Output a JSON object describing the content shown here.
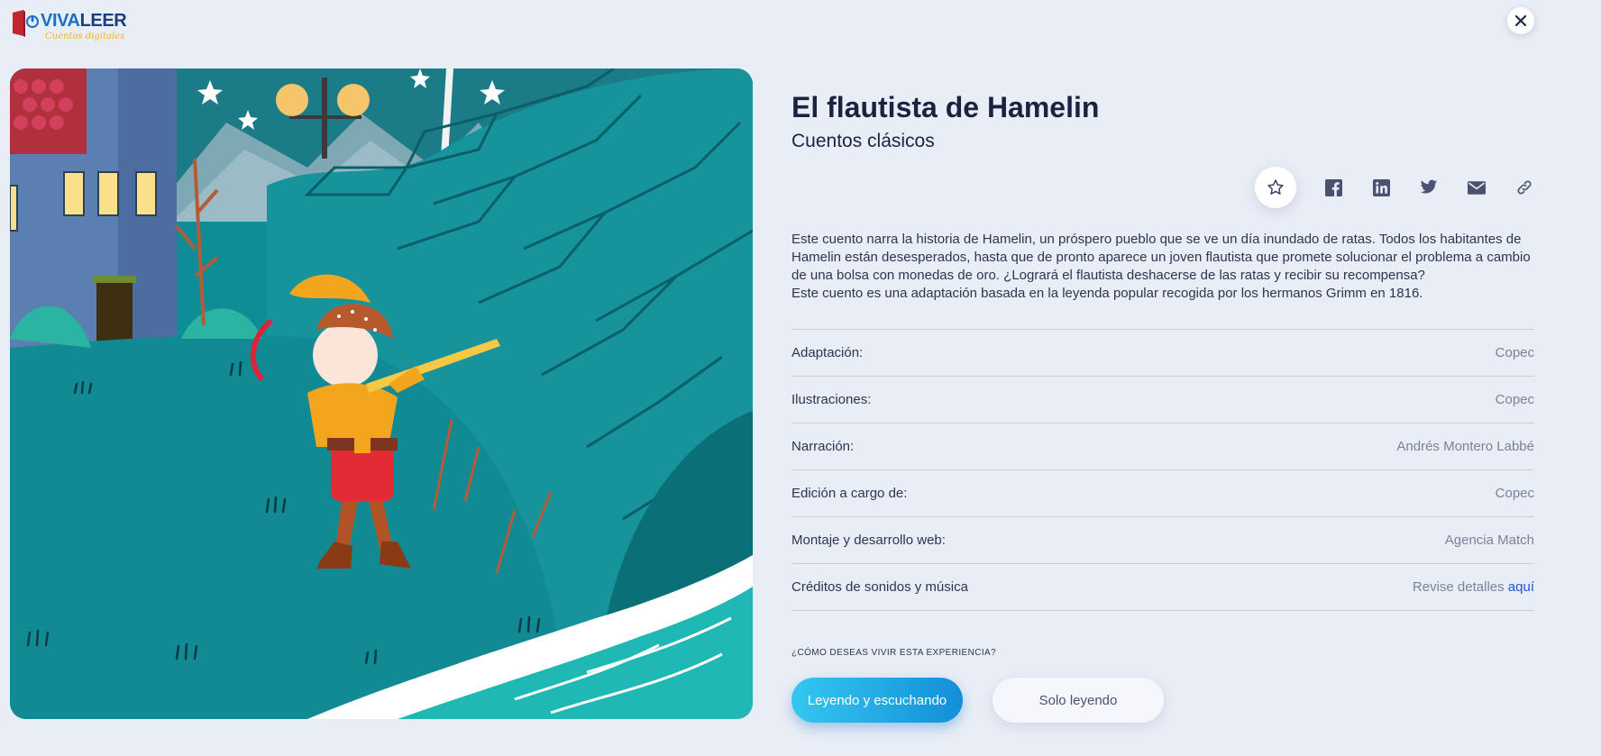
{
  "brand": {
    "name_part1": "VIVA",
    "name_part2": "LEER",
    "tagline": "Cuentos digitales"
  },
  "header": {
    "close_icon": "close-icon"
  },
  "story": {
    "title": "El flautista de Hamelin",
    "category": "Cuentos clásicos",
    "description": [
      "Este cuento narra la historia de Hamelin, un próspero pueblo que se ve un día inundado de ratas. Todos los habitantes de Hamelin están desesperados, hasta que de pronto aparece un joven flautista que promete solucionar el problema a cambio de una bolsa con monedas de oro. ¿Logrará el flautista deshacerse de las ratas y recibir su recompensa?",
      "Este cuento es una adaptación basada en la leyenda popular recogida por los hermanos Grimm en 1816."
    ]
  },
  "share": {
    "icons": [
      "star-icon",
      "facebook-icon",
      "linkedin-icon",
      "twitter-icon",
      "mail-icon",
      "link-icon"
    ]
  },
  "credits": [
    {
      "label": "Adaptación:",
      "value": "Copec"
    },
    {
      "label": "Ilustraciones:",
      "value": "Copec"
    },
    {
      "label": "Narración:",
      "value": "Andrés Montero Labbé"
    },
    {
      "label": "Edición a cargo de:",
      "value": "Copec"
    },
    {
      "label": "Montaje y desarrollo web:",
      "value": "Agencia Match"
    },
    {
      "label": "Créditos de sonidos y música",
      "value": "Revise detalles",
      "link": "aquí"
    }
  ],
  "experience": {
    "question": "¿CÓMO DESEAS VIVIR ESTA EXPERIENCIA?",
    "primary_label": "Leyendo y escuchando",
    "secondary_label": "Solo leyendo"
  },
  "colors": {
    "background": "#e9edf6",
    "accent": "#1f8fe0",
    "title": "#1b2340",
    "link": "#1f55c8",
    "brand_red": "#c4262e",
    "brand_yellow": "#f2b418"
  }
}
